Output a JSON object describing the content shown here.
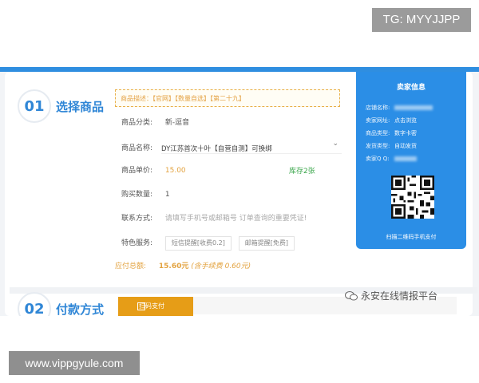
{
  "overlays": {
    "tg": "TG: MYYJJPP",
    "site": "www.vippgyule.com"
  },
  "step1": {
    "num": "01",
    "title": "选择商品"
  },
  "step2": {
    "num": "02",
    "title": "付款方式"
  },
  "notice": "商品描述：【官网】【数量自选】【第二十九】",
  "form": {
    "category_label": "商品分类:",
    "category_value": "新-逗音",
    "product_label": "商品名称:",
    "product_value": "DY江苏首次十叶【自营自测】可换绑",
    "price_label": "商品单价:",
    "price_value": "15.00",
    "stock": "库存2张",
    "qty_label": "购买数量:",
    "qty_value": "1",
    "contact_label": "联系方式:",
    "contact_placeholder": "请填写手机号或邮箱号 订单查询的重要凭证!",
    "service_label": "特色服务:",
    "service_sms": "短信提醒[收费0.2]",
    "service_email": "邮箱提醒[免费]",
    "total_label": "应付总额:",
    "total_value": "15.60元",
    "total_fee": "(含手续费 0.60元)"
  },
  "seller": {
    "title": "卖家信息",
    "shop_label": "店铺名称:",
    "site_label": "卖家网址:",
    "site_value": "点击浏览",
    "type_label": "商品类型:",
    "type_value": "数字卡密",
    "ship_label": "发货类型:",
    "ship_value": "自动发货",
    "qq_label": "卖家Q Q:",
    "scan_text": "扫描二维码手机支付"
  },
  "pay": {
    "scan_pay": "扫码支付"
  },
  "watermark": "永安在线情报平台",
  "colors": {
    "accent": "#2f86d6",
    "seller_bg": "#2b8ee6",
    "price": "#e3a340",
    "pay_btn": "#e69d17"
  }
}
